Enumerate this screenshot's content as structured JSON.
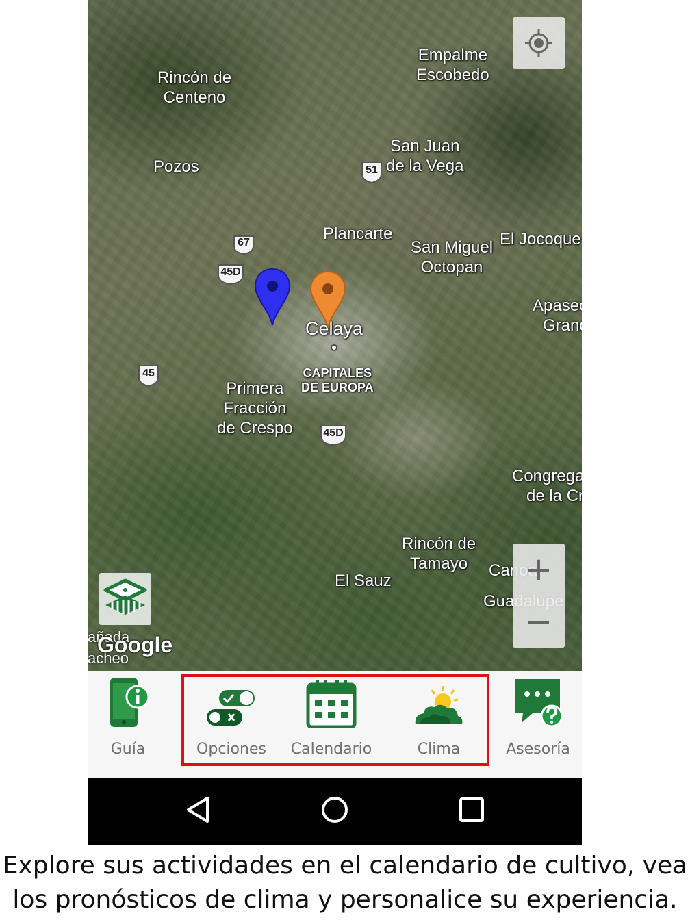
{
  "map": {
    "places": [
      {
        "id": "rincon-de-centeno",
        "lines": [
          "Rincón de",
          "Centeno"
        ]
      },
      {
        "id": "empalme-escobedo",
        "lines": [
          "Empalme",
          "Escobedo"
        ]
      },
      {
        "id": "san-juan-de-la-vega",
        "lines": [
          "San Juan",
          "de la Vega"
        ]
      },
      {
        "id": "pozos",
        "lines": [
          "Pozos"
        ]
      },
      {
        "id": "plancarte",
        "lines": [
          "Plancarte"
        ]
      },
      {
        "id": "san-miguel-octopan",
        "lines": [
          "San Miguel",
          "Octopan"
        ]
      },
      {
        "id": "el-jocoque",
        "lines": [
          "El Jocoque"
        ]
      },
      {
        "id": "apaseo-grande",
        "lines": [
          "Apaseo",
          "Grand"
        ]
      },
      {
        "id": "celaya",
        "lines": [
          "Celaya"
        ]
      },
      {
        "id": "capitales-de-europa",
        "lines": [
          "CAPITALES",
          "DE EUROPA"
        ]
      },
      {
        "id": "primera-fraccion-de-crespo",
        "lines": [
          "Primera",
          "Fracción",
          "de Crespo"
        ]
      },
      {
        "id": "congregacion-de-la-cruz",
        "lines": [
          "Congrega",
          "de la Cr"
        ]
      },
      {
        "id": "rincon-de-tamayo",
        "lines": [
          "Rincón de",
          "Tamayo"
        ]
      },
      {
        "id": "el-sauz",
        "lines": [
          "El Sauz"
        ]
      },
      {
        "id": "canoas",
        "lines": [
          "Canoa"
        ]
      },
      {
        "id": "guadalupe",
        "lines": [
          "Guadalupe"
        ]
      },
      {
        "id": "canada-de-caracheo",
        "lines": [
          "añada",
          "acheo"
        ]
      }
    ],
    "shields": {
      "s51": "51",
      "s67": "67",
      "s45d_a": "45D",
      "s45": "45",
      "s45d_b": "45D"
    },
    "attribution": "Google",
    "zoom_in": "+",
    "zoom_out": "−",
    "pins": {
      "blue": "#2f2ff0",
      "orange": "#ee8a32"
    }
  },
  "tabs": {
    "guia": "Guía",
    "opciones": "Opciones",
    "calendario": "Calendario",
    "clima": "Clima",
    "asesoria": "Asesoría"
  },
  "colors": {
    "brand_green": "#1f7a3a",
    "highlight": "#e01010"
  },
  "caption": {
    "line1": "Explore sus actividades en el calendario de cultivo, vea",
    "line2": "los pronósticos de clima y personalice su experiencia."
  }
}
